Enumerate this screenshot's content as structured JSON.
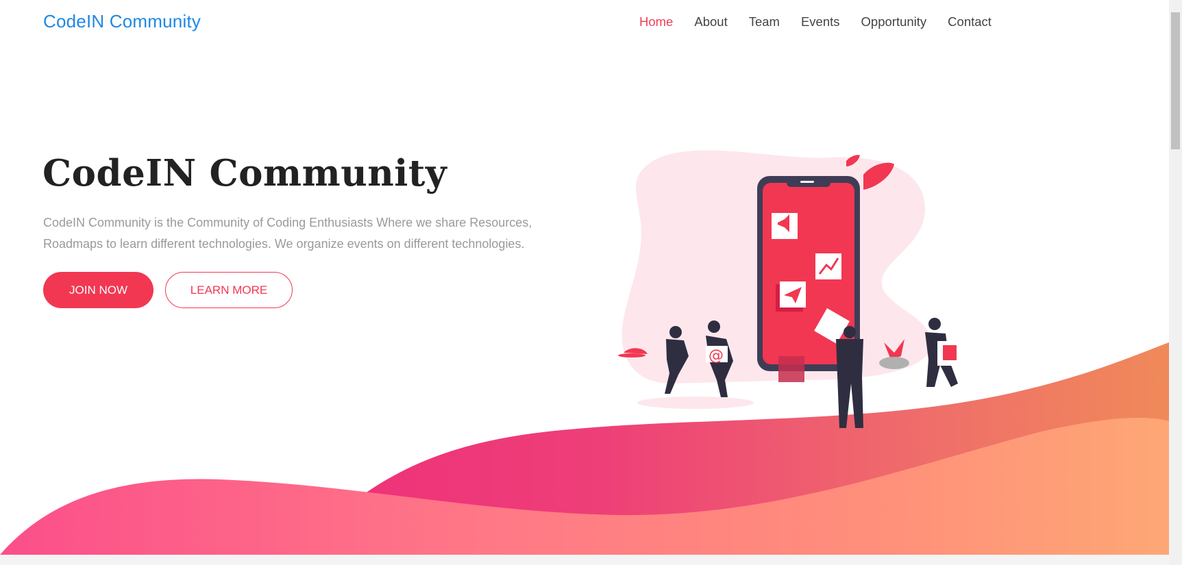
{
  "header": {
    "brand": "CodeIN Community",
    "nav": [
      {
        "label": "Home",
        "active": true
      },
      {
        "label": "About"
      },
      {
        "label": "Team"
      },
      {
        "label": "Events"
      },
      {
        "label": "Opportunity"
      },
      {
        "label": "Contact"
      }
    ]
  },
  "hero": {
    "title": "CodeIN Community",
    "description": "CodeIN Community is the Community of Coding Enthusiasts Where we share Resources, Roadmaps to learn different technologies. We organize events on different technologies.",
    "join_label": "JOIN NOW",
    "learn_label": "LEARN MORE",
    "illustration_at_symbol": "@"
  },
  "colors": {
    "accent": "#f23752",
    "brand": "#1e88e5",
    "wave_pink": "#ef3e7a",
    "wave_orange": "#f8a06e"
  }
}
